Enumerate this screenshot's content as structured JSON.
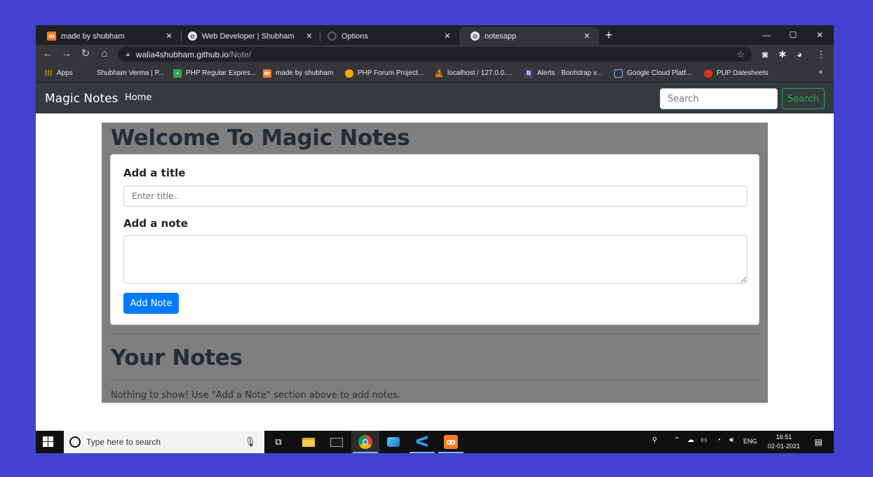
{
  "browser": {
    "tabs": [
      {
        "title": "made by shubham",
        "icon": "xampp-icon",
        "active": false
      },
      {
        "title": "Web Developer | Shubham",
        "icon": "globe-icon",
        "active": false
      },
      {
        "title": "Options",
        "icon": "github-icon",
        "active": false
      },
      {
        "title": "notesapp",
        "icon": "globe-icon",
        "active": true
      }
    ],
    "new_tab_label": "+",
    "window_controls": {
      "minimize": "—",
      "maximize": "☐",
      "close": "✕"
    },
    "url_host": "walia4shubham.github.io",
    "url_path": "/Note/",
    "bookmarks": [
      {
        "label": "Apps",
        "icon": "apps-grid-icon"
      },
      {
        "label": "Shubham Verma | P...",
        "icon": "none"
      },
      {
        "label": "PHP Regular Expres...",
        "icon": "image-icon"
      },
      {
        "label": "made by shubham",
        "icon": "xampp-icon"
      },
      {
        "label": "PHP Forum Project...",
        "icon": "globe-icon"
      },
      {
        "label": "localhost / 127.0.0....",
        "icon": "phpmyadmin-icon"
      },
      {
        "label": "Alerts · Bootstrap v...",
        "icon": "bootstrap-icon"
      },
      {
        "label": "Google Cloud Platf...",
        "icon": "gcp-icon"
      },
      {
        "label": "PUP Datesheets",
        "icon": "pup-icon"
      }
    ],
    "bookmarks_more": "»"
  },
  "page": {
    "brand": "Magic Notes",
    "nav_home": "Home",
    "search_placeholder": "Search",
    "search_button": "Search",
    "welcome_heading": "Welcome To Magic Notes",
    "title_label": "Add a title",
    "title_placeholder": "Enter title..",
    "note_label": "Add a note",
    "note_value": "",
    "add_note_button": "Add Note",
    "your_notes_heading": "Your Notes",
    "empty_message": "Nothing to show! Use \"Add a Note\" section above to add notes."
  },
  "colors": {
    "navbar": "#343a40",
    "primary": "#007bff",
    "success": "#28a745",
    "desktop": "#4242cf"
  },
  "taskbar": {
    "search_placeholder": "Type here to search",
    "apps": [
      "task-view-icon",
      "file-explorer-icon",
      "terminal-icon",
      "chrome-icon",
      "edge-dev-icon",
      "vscode-icon",
      "xampp-icon"
    ],
    "language": "ENG",
    "time": "16:51",
    "date": "02-01-2021"
  }
}
